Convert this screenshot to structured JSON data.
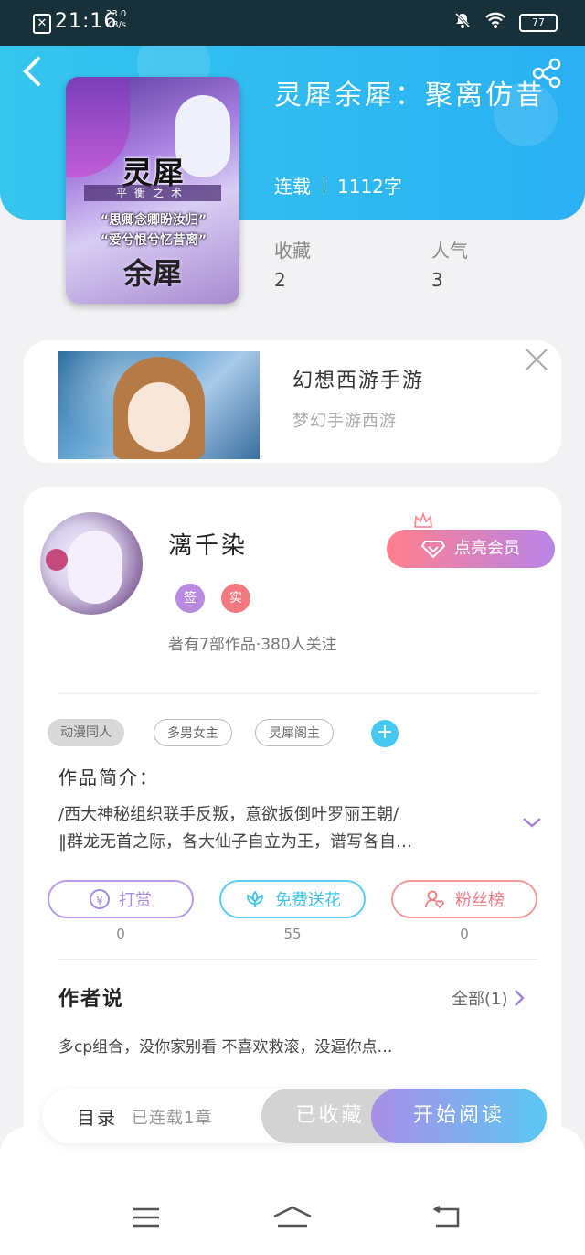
{
  "status_bar": {
    "time": "21:16",
    "speed_value": "23.0",
    "speed_unit": "KB/s",
    "battery": "77"
  },
  "header": {
    "title": "灵犀余犀：聚离仿昔",
    "status": "连载",
    "word_count": "1112字",
    "stats": [
      {
        "label": "收藏",
        "value": "2"
      },
      {
        "label": "人气",
        "value": "3"
      }
    ]
  },
  "cover": {
    "title_top": "灵犀",
    "subtitle": "平衡之术",
    "line1": "“思卿念卿盼汝归”",
    "line2": "“爱兮恨兮忆昔离”",
    "title_bottom": "余犀"
  },
  "ad": {
    "title": "幻想西游手游",
    "subtitle": "梦幻手游西游"
  },
  "author": {
    "name": "漓千染",
    "badges": [
      {
        "label": "签",
        "color": "#b88ae0"
      },
      {
        "label": "实",
        "color": "#f07a80"
      }
    ],
    "stats": "著有7部作品·380人关注",
    "vip_label": "点亮会员"
  },
  "tags": [
    "动漫同人",
    "多男女主",
    "灵犀阁主"
  ],
  "intro": {
    "label": "作品简介：",
    "line1": "/西大神秘组织联手反叛，意欲扳倒叶罗丽王朝/",
    "line2": "‖群龙无首之际，各大仙子自立为王，谱写各自…"
  },
  "actions": [
    {
      "label": "打赏",
      "count": "0",
      "color": "#a78be0"
    },
    {
      "label": "免费送花",
      "count": "55",
      "color": "#3fc3ec"
    },
    {
      "label": "粉丝榜",
      "count": "0",
      "color": "#f07a80"
    }
  ],
  "author_says": {
    "label": "作者说",
    "all": "全部(1)",
    "text": "多cp组合，没你家别看 不喜欢救滚，没逼你点…"
  },
  "bottom_bar": {
    "toc": "目录",
    "toc_status": "已连载1章",
    "collected": "已收藏",
    "read": "开始阅读"
  }
}
